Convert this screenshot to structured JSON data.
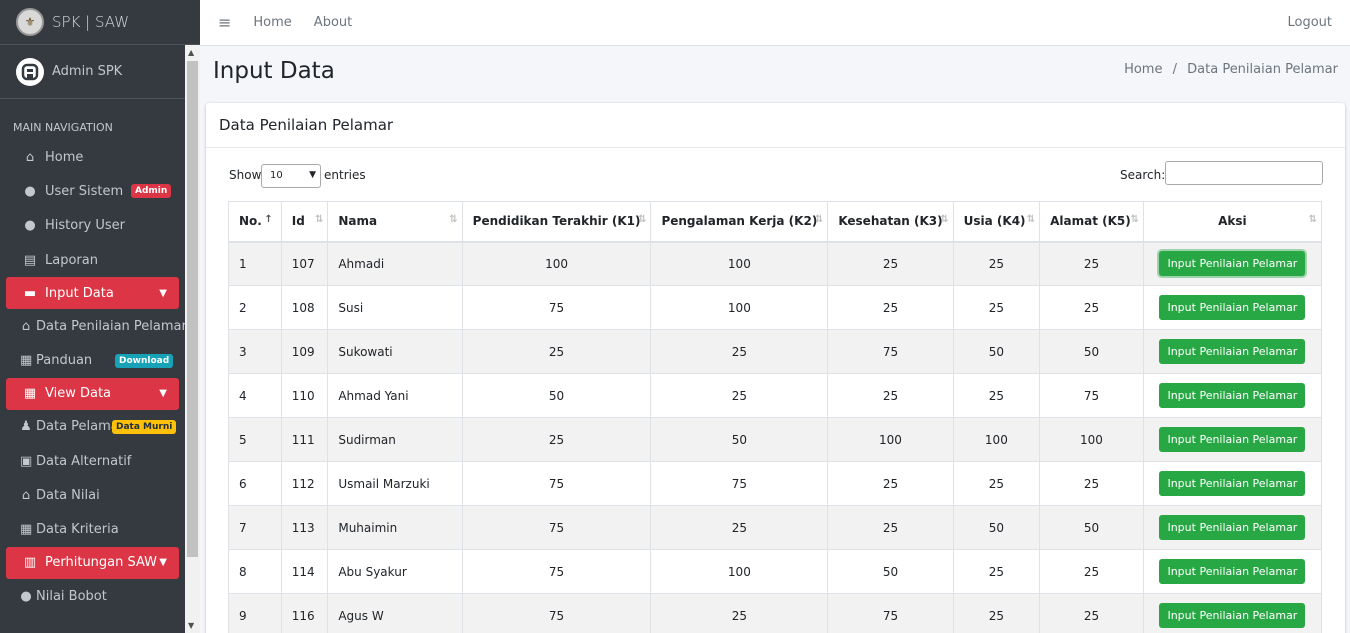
{
  "brand": {
    "name": "SPK | SAW"
  },
  "user": {
    "name": "Admin SPK"
  },
  "sidebar": {
    "header": "MAIN NAVIGATION",
    "items": [
      {
        "label": "Home",
        "icon": "home-icon"
      },
      {
        "label": "User Sistem",
        "icon": "user-icon",
        "badge": "Admin"
      },
      {
        "label": "History User",
        "icon": "users-icon"
      },
      {
        "label": "Laporan",
        "icon": "file-icon"
      },
      {
        "label": "Input Data",
        "icon": "list-alt-icon"
      },
      {
        "label": "Data Penilaian Pelamar",
        "icon": "bank-icon"
      },
      {
        "label": "Panduan",
        "icon": "table-icon",
        "badge": "Download"
      },
      {
        "label": "View Data",
        "icon": "table-icon"
      },
      {
        "label": "Data Pelamar",
        "icon": "male-icon",
        "badge": "Data Murni"
      },
      {
        "label": "Data Alternatif",
        "icon": "archive-icon"
      },
      {
        "label": "Data Nilai",
        "icon": "bank-icon"
      },
      {
        "label": "Data Kriteria",
        "icon": "table-icon"
      },
      {
        "label": "Perhitungan SAW",
        "icon": "calculator-icon"
      },
      {
        "label": "Nilai Bobot",
        "icon": "user-icon"
      }
    ]
  },
  "topnav": {
    "home": "Home",
    "about": "About",
    "logout": "Logout"
  },
  "page": {
    "title": "Input Data"
  },
  "breadcrumb": {
    "home": "Home",
    "current": "Data Penilaian Pelamar"
  },
  "card": {
    "title": "Data Penilaian Pelamar"
  },
  "controls": {
    "show": "Show",
    "page_size": "10",
    "entries": "entries",
    "search": "Search:"
  },
  "table": {
    "headers": [
      "No.",
      "Id",
      "Nama",
      "Pendidikan Terakhir (K1)",
      "Pengalaman Kerja (K2)",
      "Kesehatan (K3)",
      "Usia (K4)",
      "Alamat (K5)",
      "Aksi"
    ],
    "action_label": "Input Penilaian Pelamar",
    "rows": [
      [
        "1",
        "107",
        "Ahmadi",
        "100",
        "100",
        "25",
        "25",
        "25"
      ],
      [
        "2",
        "108",
        "Susi",
        "75",
        "100",
        "25",
        "25",
        "25"
      ],
      [
        "3",
        "109",
        "Sukowati",
        "25",
        "25",
        "75",
        "50",
        "50"
      ],
      [
        "4",
        "110",
        "Ahmad Yani",
        "50",
        "25",
        "25",
        "25",
        "75"
      ],
      [
        "5",
        "111",
        "Sudirman",
        "25",
        "50",
        "100",
        "100",
        "100"
      ],
      [
        "6",
        "112",
        "Usmail Marzuki",
        "75",
        "75",
        "25",
        "25",
        "25"
      ],
      [
        "7",
        "113",
        "Muhaimin",
        "75",
        "25",
        "25",
        "50",
        "50"
      ],
      [
        "8",
        "114",
        "Abu Syakur",
        "75",
        "100",
        "50",
        "25",
        "25"
      ],
      [
        "9",
        "116",
        "Agus W",
        "75",
        "25",
        "75",
        "25",
        "25"
      ]
    ]
  },
  "colors": {
    "sidebar": "#343a40",
    "active": "#dc3545",
    "action": "#28a745"
  }
}
